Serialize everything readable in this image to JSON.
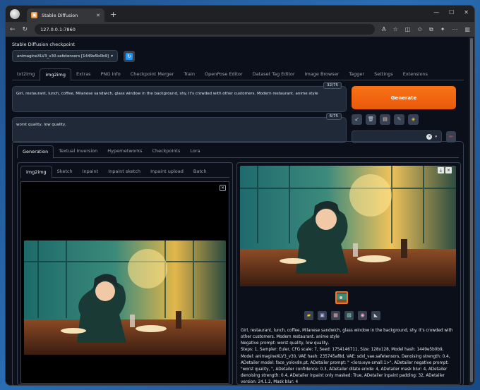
{
  "browser": {
    "tab_title": "Stable Diffusion",
    "url": "127.0.0.1:7860"
  },
  "checkpoint": {
    "label": "Stable Diffusion checkpoint",
    "value": "animagineXLV3_v30.safetensors [1449e5b0b9]"
  },
  "main_tabs": [
    "txt2img",
    "img2img",
    "Extras",
    "PNG Info",
    "Checkpoint Merger",
    "Train",
    "OpenPose Editor",
    "Dataset Tag Editor",
    "Image Browser",
    "Tagger",
    "Settings",
    "Extensions"
  ],
  "prompt": {
    "positive": "Girl, restaurant, lunch, coffee, Milanese sandwich, glass window in the background, shy. It's crowded with other customers. Modern restaurant. anime style",
    "positive_count": "32/75",
    "negative": "worst quality, low quality,",
    "negative_count": "6/75"
  },
  "generate_label": "Generate",
  "sub_tabs": [
    "Generation",
    "Textual Inversion",
    "Hypernetworks",
    "Checkpoints",
    "Lora"
  ],
  "mode_tabs": [
    "img2img",
    "Sketch",
    "Inpaint",
    "Inpaint sketch",
    "Inpaint upload",
    "Batch"
  ],
  "output_info": {
    "prompt": "Girl, restaurant, lunch, coffee, Milanese sandwich, glass window in the background, shy. It's crowded with other customers. Modern restaurant. anime style",
    "negative": "Negative prompt: worst quality, low quality,",
    "params": "Steps: 1, Sampler: Euler, CFG scale: 7, Seed: 1754146711, Size: 128x128, Model hash: 1449e5b0b9, Model: animagineXLV3_v30, VAE hash: 235745af8d, VAE: sdxl_vae.safetensors, Denoising strength: 0.4, ADetailer model: face_yolov8n.pt, ADetailer prompt: \" <lora:eye-small:1>\", ADetailer negative prompt: \"worst quality, \", ADetailer confidence: 0.3, ADetailer dilate erode: 4, ADetailer mask blur: 4, ADetailer denoising strength: 0.4, ADetailer inpaint only masked: True, ADetailer inpaint padding: 32, ADetailer version: 24.1.2, Mask blur: 4"
  },
  "colors": {
    "accent": "#f97316",
    "background": "#0b0f19"
  }
}
